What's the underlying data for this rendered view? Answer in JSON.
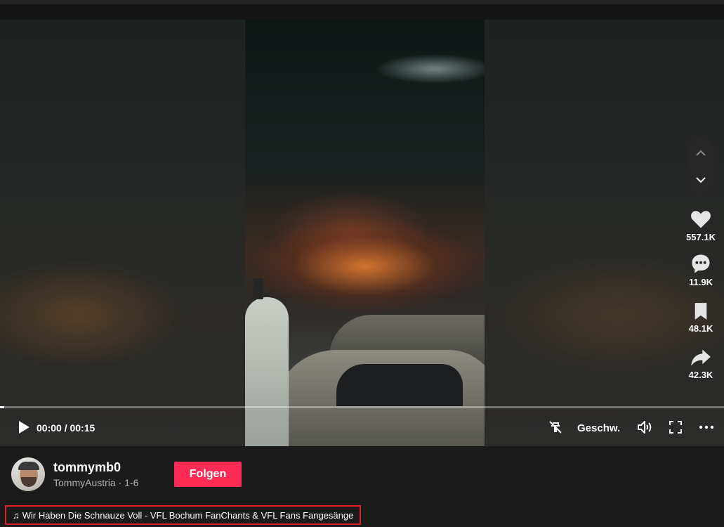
{
  "video": {
    "progress_fraction": 0.005,
    "time_current": "00:00",
    "time_total": "00:15",
    "time_display": "00:00 / 00:15",
    "speed_label": "Geschw."
  },
  "actions": {
    "likes": "557.1K",
    "comments": "11.9K",
    "saves": "48.1K",
    "shares": "42.3K"
  },
  "author": {
    "username": "tommymb0",
    "nickname": "TommyAustria · 1-6",
    "follow_label": "Folgen"
  },
  "music": {
    "note_glyph": "♫",
    "title": "Wir Haben Die Schnauze Voll - VFL Bochum FanChants & VFL Fans Fangesänge"
  },
  "colors": {
    "accent": "#fe2c55",
    "highlight_border": "#e0202a"
  }
}
